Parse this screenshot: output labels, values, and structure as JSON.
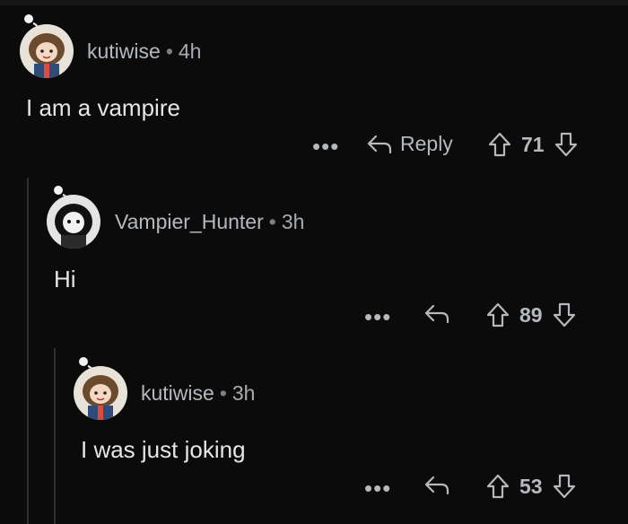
{
  "comments": [
    {
      "username": "kutiwise",
      "separator": "•",
      "time": "4h",
      "text": "I am a vampire",
      "more_label": "•••",
      "reply_label": "Reply",
      "score": "71"
    },
    {
      "username": "Vampier_Hunter",
      "separator": "•",
      "time": "3h",
      "text": "Hi",
      "more_label": "•••",
      "score": "89"
    },
    {
      "username": "kutiwise",
      "separator": "•",
      "time": "3h",
      "text": "I was just joking",
      "more_label": "•••",
      "score": "53"
    }
  ],
  "icons": {
    "reply": "reply-arrow-icon",
    "upvote": "upvote-arrow-icon",
    "downvote": "downvote-arrow-icon",
    "more": "more-options-icon",
    "avatar": "avatar-icon"
  },
  "colors": {
    "background": "#0b0b0b",
    "text": "#e6e6e6",
    "muted": "#a8acb0",
    "thread_line": "#2f2f2f"
  }
}
